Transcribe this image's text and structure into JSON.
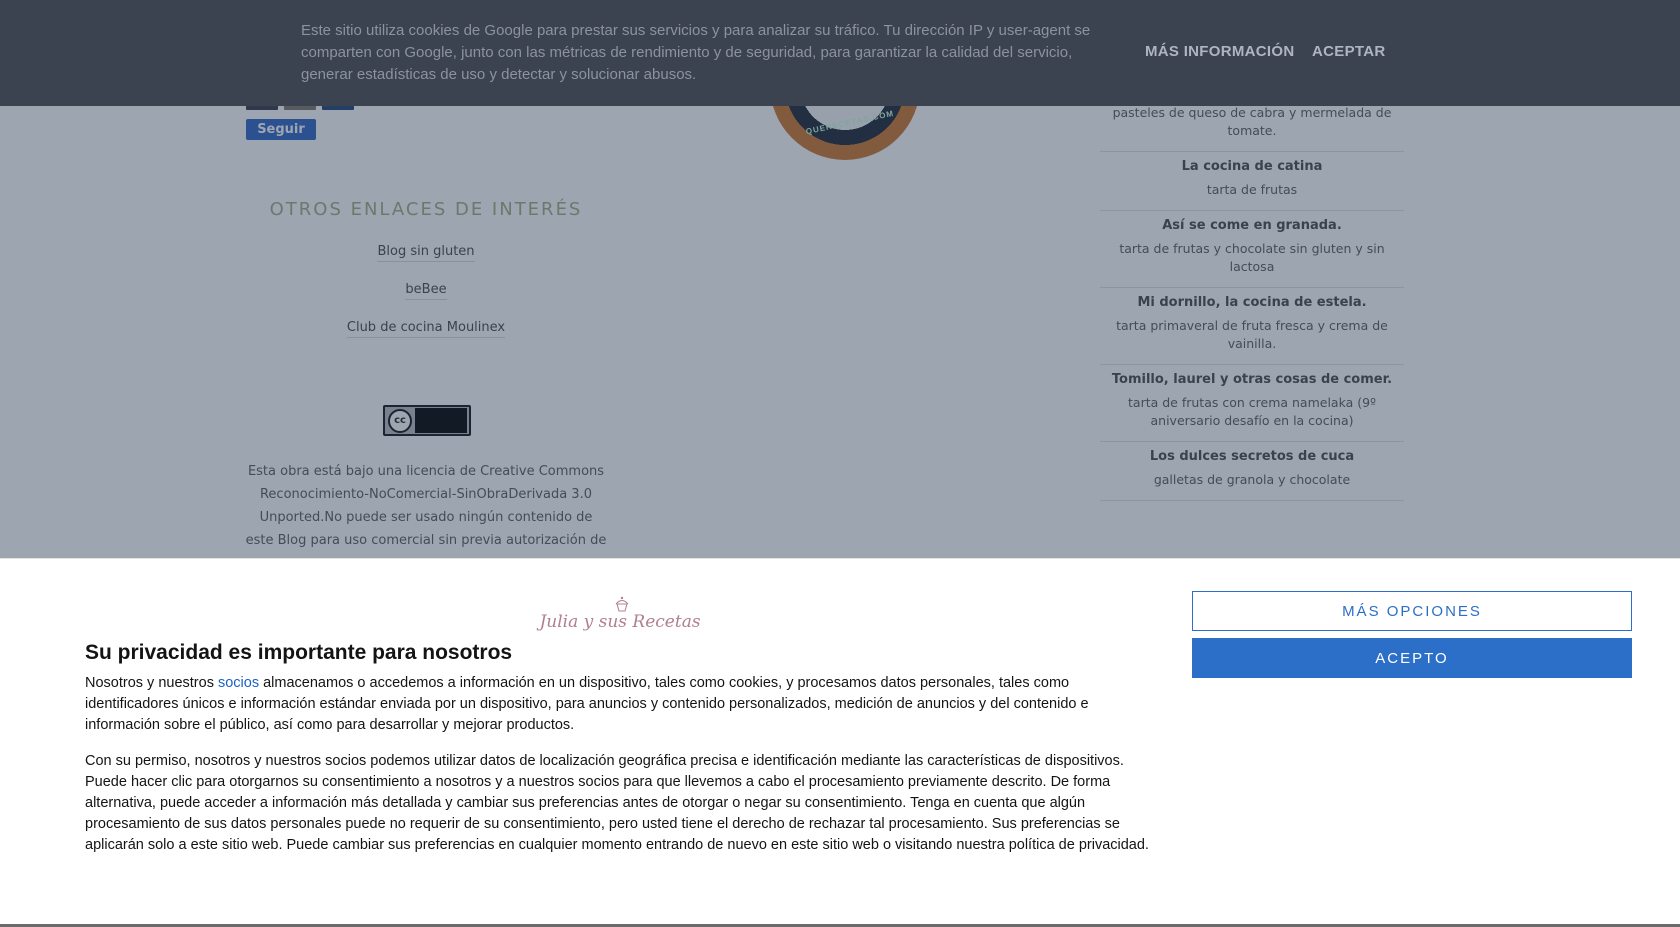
{
  "page": {
    "follow_label": "Seguir",
    "links_title": "OTROS ENLACES DE INTERÉS",
    "links": [
      "Blog sin gluten",
      "beBee",
      "Club de cocina Moulinex"
    ],
    "license_text": "Esta obra está bajo una licencia de Creative Commons Reconocimiento-NoComercial-SinObraDerivada 3.0 Unported.No puede ser usado ningún contenido de este Blog para uso comercial sin previa autorización de",
    "cc_label": "cc",
    "seal_text": "QUERECETAS.COM",
    "blog_roll": [
      {
        "blog": "",
        "post": "pasteles de queso de cabra y mermelada de tomate."
      },
      {
        "blog": "La cocina de catina",
        "post": "tarta de frutas"
      },
      {
        "blog": "Así se come en granada.",
        "post": "tarta de frutas y chocolate sin gluten y sin lactosa"
      },
      {
        "blog": "Mi dornillo, la cocina de estela.",
        "post": "tarta primaveral de fruta fresca y crema de vainilla."
      },
      {
        "blog": "Tomillo, laurel y otras cosas de comer.",
        "post": "tarta de frutas con crema namelaka (9º aniversario desafío en la cocina)"
      },
      {
        "blog": "Los dulces secretos de cuca",
        "post": "galletas de granola y chocolate"
      }
    ]
  },
  "cookie_bar": {
    "text": "Este sitio utiliza cookies de Google para prestar sus servicios y para analizar su tráfico. Tu dirección IP y user-agent se comparten con Google, junto con las métricas de rendimiento y de seguridad, para garantizar la calidad del servicio, generar estadísticas de uso y detectar y solucionar abusos.",
    "more_label": "MÁS INFORMACIÓN",
    "accept_label": "ACEPTAR"
  },
  "consent": {
    "logo_text": "Julia y sus Recetas",
    "title": "Su privacidad es importante para nosotros",
    "p1_before": "Nosotros y nuestros ",
    "p1_link": "socios",
    "p1_after": " almacenamos o accedemos a información en un dispositivo, tales como cookies, y procesamos datos personales, tales como identificadores únicos e información estándar enviada por un dispositivo, para anuncios y contenido personalizados, medición de anuncios y del contenido e información sobre el público, así como para desarrollar y mejorar productos.",
    "p2": "Con su permiso, nosotros y nuestros socios podemos utilizar datos de localización geográfica precisa e identificación mediante las características de dispositivos. Puede hacer clic para otorgarnos su consentimiento a nosotros y a nuestros socios para que llevemos a cabo el procesamiento previamente descrito. De forma alternativa, puede acceder a información más detallada y cambiar sus preferencias antes de otorgar o negar su consentimiento. Tenga en cuenta que algún procesamiento de sus datos personales puede no requerir de su consentimiento, pero usted tiene el derecho de rechazar tal procesamiento. Sus preferencias se aplicarán solo a este sitio web. Puede cambiar sus preferencias en cualquier momento entrando de nuevo en este sitio web o visitando nuestra política de privacidad.",
    "options_label": "MÁS OPCIONES",
    "accept_label": "ACEPTO"
  }
}
